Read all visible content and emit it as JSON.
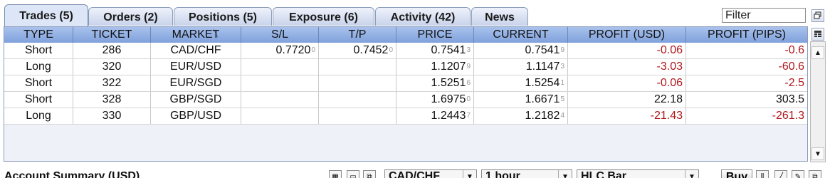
{
  "tabs": [
    {
      "label": "Trades (5)",
      "active": true
    },
    {
      "label": "Orders (2)",
      "active": false
    },
    {
      "label": "Positions (5)",
      "active": false
    },
    {
      "label": "Exposure (6)",
      "active": false
    },
    {
      "label": "Activity (42)",
      "active": false
    },
    {
      "label": "News",
      "active": false
    }
  ],
  "filter": {
    "placeholder": "Filter"
  },
  "columns": [
    "TYPE",
    "TICKET",
    "MARKET",
    "S/L",
    "T/P",
    "PRICE",
    "CURRENT",
    "PROFIT (USD)",
    "PROFIT (PIPS)"
  ],
  "rows": [
    {
      "type": "Short",
      "ticket": "286",
      "market": "CAD/CHF",
      "sl": "0.7720",
      "sl_pip": "0",
      "tp": "0.7452",
      "tp_pip": "0",
      "price": "0.7541",
      "price_pip": "3",
      "current": "0.7541",
      "current_pip": "9",
      "profit_usd": "-0.06",
      "profit_pips": "-0.6"
    },
    {
      "type": "Long",
      "ticket": "320",
      "market": "EUR/USD",
      "sl": "",
      "sl_pip": "",
      "tp": "",
      "tp_pip": "",
      "price": "1.1207",
      "price_pip": "9",
      "current": "1.1147",
      "current_pip": "3",
      "profit_usd": "-3.03",
      "profit_pips": "-60.6"
    },
    {
      "type": "Short",
      "ticket": "322",
      "market": "EUR/SGD",
      "sl": "",
      "sl_pip": "",
      "tp": "",
      "tp_pip": "",
      "price": "1.5251",
      "price_pip": "6",
      "current": "1.5254",
      "current_pip": "1",
      "profit_usd": "-0.06",
      "profit_pips": "-2.5"
    },
    {
      "type": "Short",
      "ticket": "328",
      "market": "GBP/SGD",
      "sl": "",
      "sl_pip": "",
      "tp": "",
      "tp_pip": "",
      "price": "1.6975",
      "price_pip": "0",
      "current": "1.6671",
      "current_pip": "5",
      "profit_usd": "22.18",
      "profit_pips": "303.5"
    },
    {
      "type": "Long",
      "ticket": "330",
      "market": "GBP/USD",
      "sl": "",
      "sl_pip": "",
      "tp": "",
      "tp_pip": "",
      "price": "1.2443",
      "price_pip": "7",
      "current": "1.2182",
      "current_pip": "4",
      "profit_usd": "-21.43",
      "profit_pips": "-261.3"
    }
  ],
  "bottom": {
    "summary_title": "Account Summary (USD)",
    "market_select": "CAD/CHF",
    "interval_select": "1 hour",
    "chart_type_select": "HLC Bar",
    "buy_label": "Buy"
  },
  "colors": {
    "negative": "#b0171b",
    "header": "#8fb0e4",
    "tab_active": "#dde6f7"
  },
  "icons": [
    "restore-window-icon",
    "column-chooser-icon",
    "scroll-up-icon",
    "scroll-down-icon",
    "grid-view-icon",
    "chart-icon",
    "popout-icon",
    "dropdown-arrow-icon"
  ]
}
